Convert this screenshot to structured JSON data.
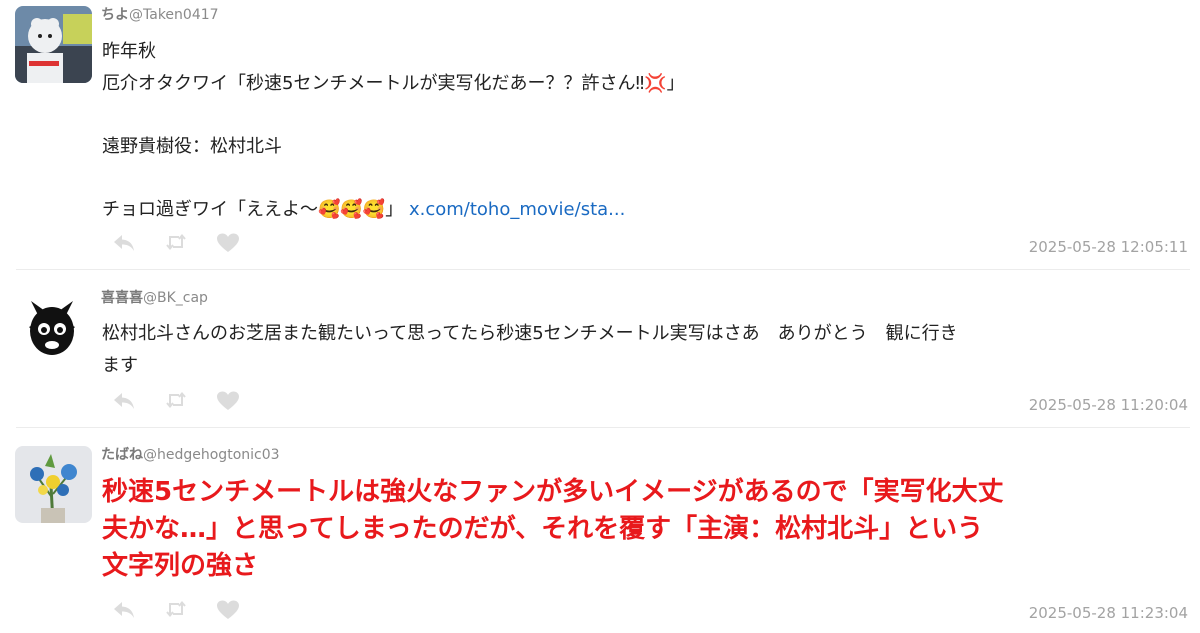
{
  "tweets": [
    {
      "display_name": "ちよ",
      "handle": "@Taken0417",
      "lines": [
        "昨年秋",
        "厄介オタクワイ「秒速5センチメートルが実写化だあー？？許さん‼💢」",
        "",
        "遠野貴樹役：松村北斗",
        "",
        "チョロ過ぎワイ「ええよ〜🥰🥰🥰」"
      ],
      "link": "x.com/toho_movie/sta...",
      "timestamp": "2025-05-28 12:05:11"
    },
    {
      "display_name": "喜喜喜",
      "handle": "@BK_cap",
      "lines": [
        "松村北斗さんのお芝居また観たいって思ってたら秒速5センチメートル実写はさあ　ありがとう　観に行き",
        "ます"
      ],
      "timestamp": "2025-05-28 11:20:04"
    },
    {
      "display_name": "たばね",
      "handle": "@hedgehogtonic03",
      "emphasis_lines": [
        "秒速5センチメートルは強火なファンが多いイメージがあるので「実写化大丈",
        "夫かな…」と思ってしまったのだが、それを覆す「主演：松村北斗」という",
        "文字列の強さ"
      ],
      "timestamp": "2025-05-28 11:23:04"
    }
  ],
  "icons": {
    "reply": "reply-icon",
    "retweet": "retweet-icon",
    "like": "heart-icon"
  },
  "colors": {
    "link": "#1a6ac2",
    "emphasis": "#e8191c",
    "icon": "#dcdcdc",
    "timestamp": "#a3a3a3"
  }
}
